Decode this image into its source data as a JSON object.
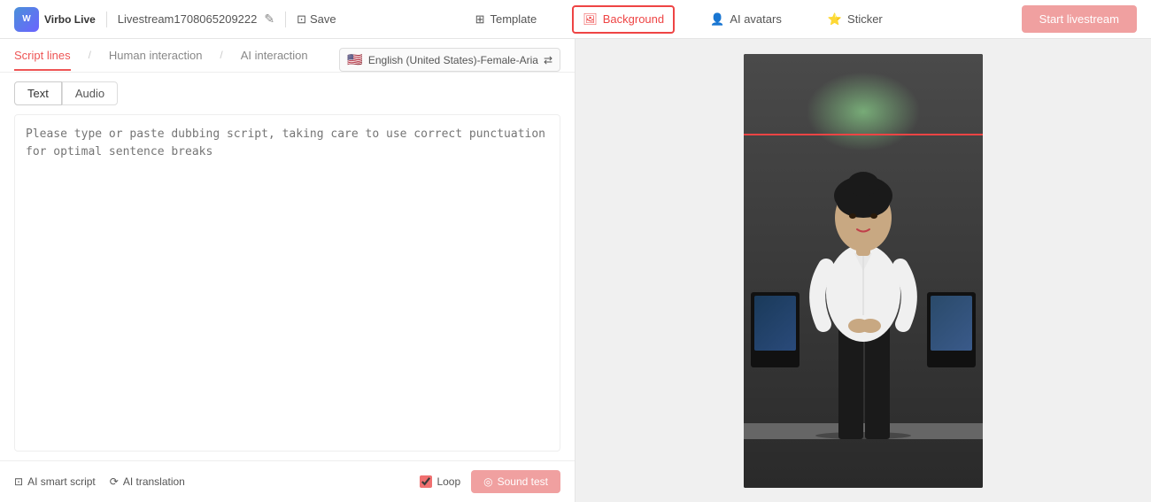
{
  "app": {
    "logo_text": "Virbo Live",
    "project_name": "Livestream1708065209222",
    "save_label": "Save"
  },
  "navbar": {
    "template_label": "Template",
    "background_label": "Background",
    "ai_avatars_label": "AI avatars",
    "sticker_label": "Sticker",
    "start_label": "Start livestream"
  },
  "script": {
    "tab_script_lines": "Script lines",
    "tab_human": "Human interaction",
    "tab_ai": "AI interaction",
    "lang": "English (United States)-Female-Aria",
    "tab_text": "Text",
    "tab_audio": "Audio",
    "placeholder": "Please type or paste dubbing script, taking care to use correct punctuation for optimal sentence breaks"
  },
  "bottom": {
    "ai_smart_script": "AI smart script",
    "ai_translation": "AI translation",
    "loop_label": "Loop",
    "sound_test_label": "Sound test"
  },
  "icons": {
    "edit": "✎",
    "save": "⊡",
    "template": "⊞",
    "background": "⊟",
    "ai_avatars": "👤",
    "sticker": "⭐",
    "smart_script": "⊡",
    "translation": "⟳",
    "sound": "◎",
    "swap": "⇄"
  },
  "colors": {
    "accent": "#e55",
    "active_border": "#e44",
    "button_disabled": "#f0a0a0",
    "tab_active_color": "#e55"
  }
}
